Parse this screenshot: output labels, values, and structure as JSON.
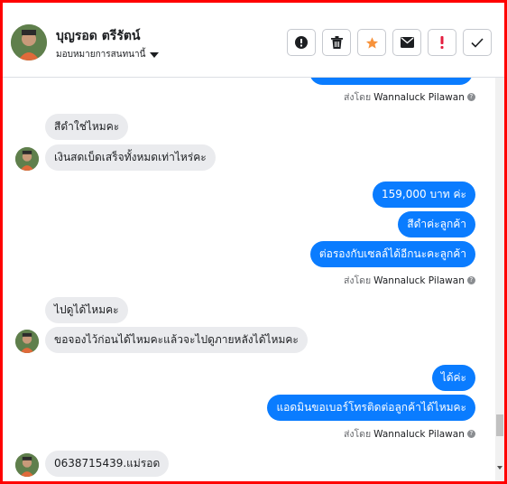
{
  "header": {
    "contact_name": "บุญรอด ตรีรัตน์",
    "assign_label": "มอบหมายการสนทนานี้"
  },
  "toolbar": [
    {
      "name": "alert-circle-icon",
      "kind": "alert"
    },
    {
      "name": "trash-icon",
      "kind": "trash"
    },
    {
      "name": "star-icon",
      "kind": "star"
    },
    {
      "name": "mail-icon",
      "kind": "mail"
    },
    {
      "name": "exclamation-icon",
      "kind": "excl"
    },
    {
      "name": "check-icon",
      "kind": "check"
    }
  ],
  "colors": {
    "frame": "#ff0000",
    "outgoing": "#0a7cff",
    "incoming": "#eaebee",
    "star": "#f7923b",
    "excl": "#e41e3f"
  },
  "conversation": {
    "sent_by_prefix": "ส่งโดย",
    "sender_name": "Wannaluck Pilawan",
    "messages": [
      {
        "dir": "in",
        "text": "สีดำใช่ไหมคะ"
      },
      {
        "dir": "in",
        "text": "เงินสดเบ็ดเสร็จทั้งหมดเท่าไหร่คะ"
      },
      {
        "dir": "out",
        "text": "159,000 บาท   ค่ะ"
      },
      {
        "dir": "out",
        "text": "สีดำค่ะลูกค้า"
      },
      {
        "dir": "out",
        "text": "ต่อรองกับเซลล์ได้อีกนะคะลูกค้า"
      },
      {
        "dir": "in",
        "text": "ไปดูได้ไหมคะ"
      },
      {
        "dir": "in",
        "text": "ขอจองไว้ก่อนได้ไหมคะแล้วจะไปดูภายหลังได้ไหมคะ"
      },
      {
        "dir": "out",
        "text": "ได้ค่ะ"
      },
      {
        "dir": "out",
        "text": "แอดมินขอเบอร์โทรติดต่อลูกค้าได้ไหมคะ"
      },
      {
        "dir": "in",
        "text": "0638715439.แม่รอด"
      }
    ]
  }
}
